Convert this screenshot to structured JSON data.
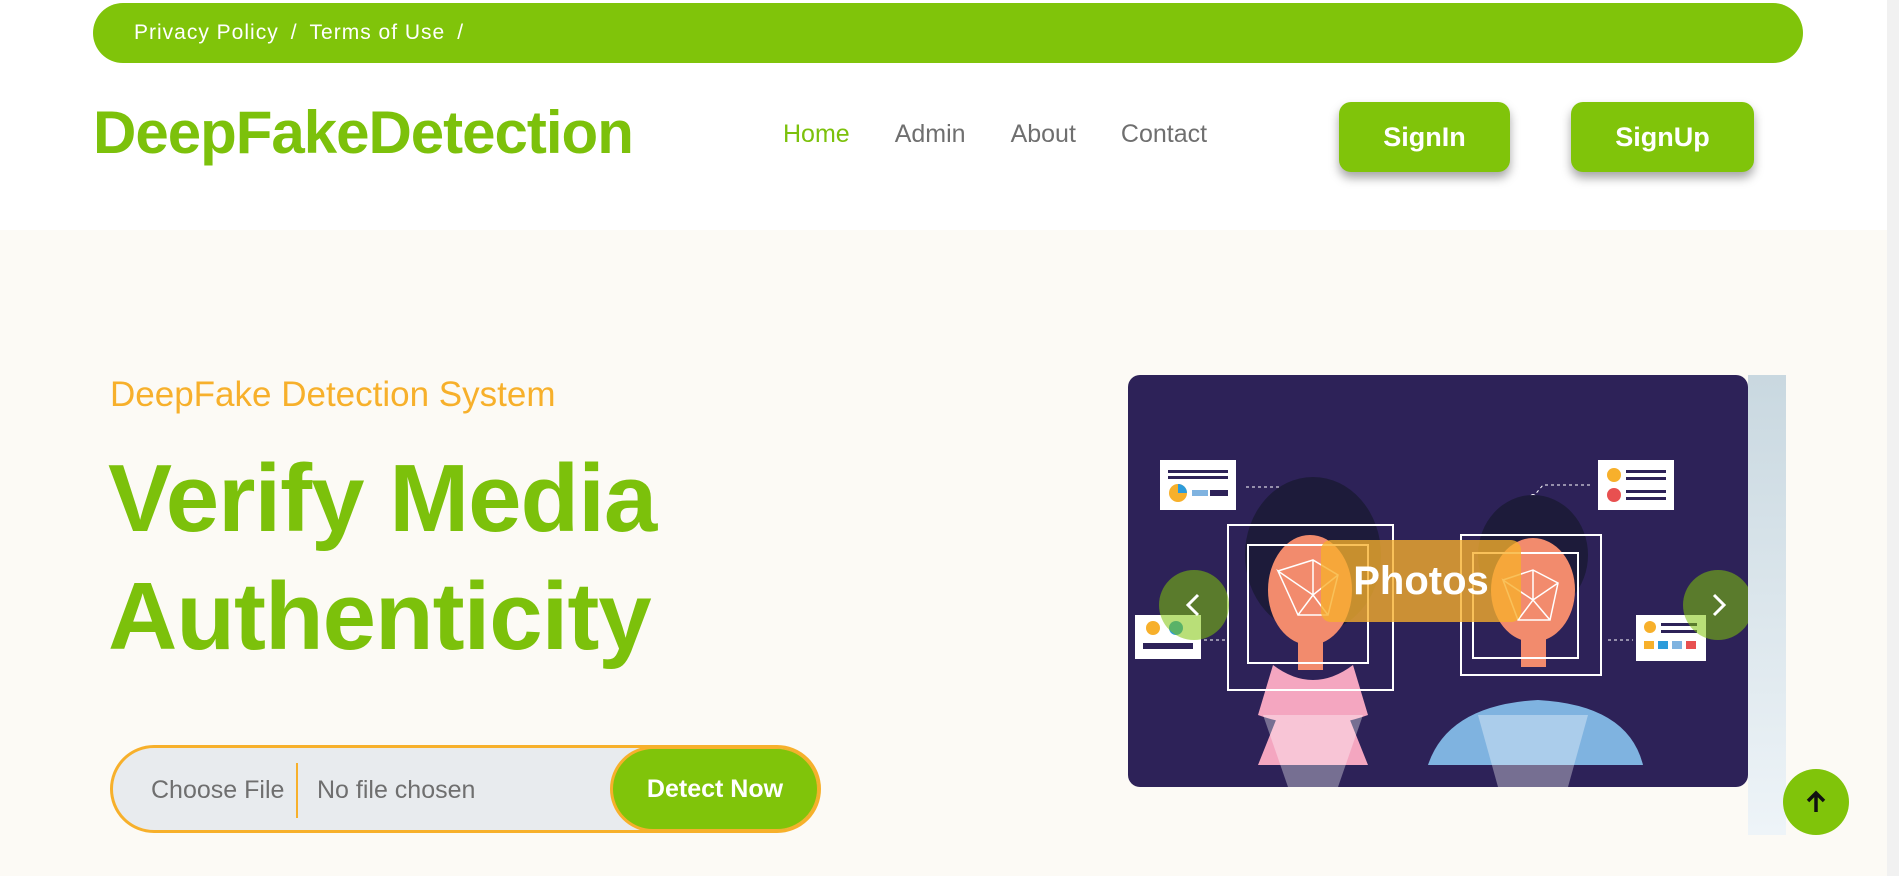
{
  "topbar": {
    "links": [
      "Privacy Policy",
      "Terms of Use"
    ],
    "separator": "/"
  },
  "header": {
    "brand": "DeepFakeDetection",
    "nav": [
      "Home",
      "Admin",
      "About",
      "Contact"
    ],
    "active_nav": "Home",
    "signin_label": "SignIn",
    "signup_label": "SignUp"
  },
  "hero": {
    "subtitle": "DeepFake Detection System",
    "headline_line1": "Verify Media",
    "headline_line2": "Authenticity",
    "choose_file_label": "Choose File",
    "no_file_text": "No file chosen",
    "detect_button": "Detect Now"
  },
  "carousel": {
    "caption": "Photos"
  },
  "colors": {
    "brand_green": "#80c40a",
    "accent_orange": "#f7b02b",
    "carousel_bg": "#2d2258"
  },
  "icons": {
    "prev": "chevron-left-icon",
    "next": "chevron-right-icon",
    "to_top": "arrow-up-icon"
  }
}
